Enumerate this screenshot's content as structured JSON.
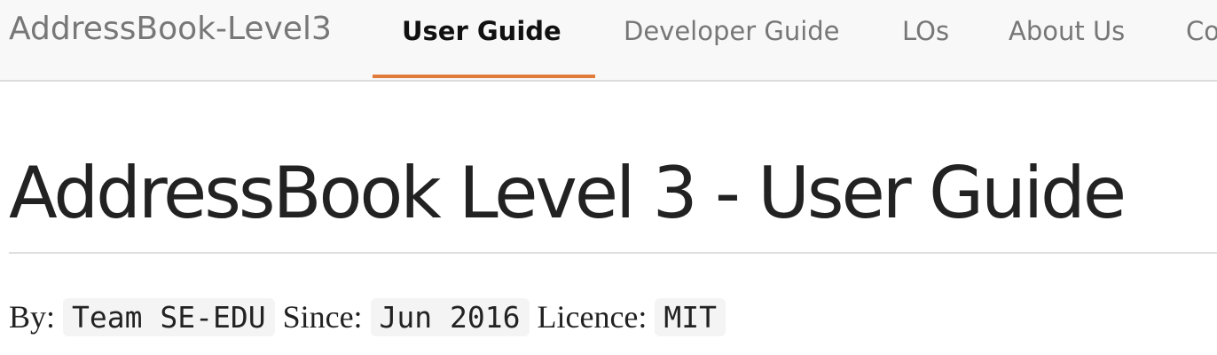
{
  "navbar": {
    "brand": "AddressBook-Level3",
    "items": [
      {
        "label": "User Guide",
        "active": true
      },
      {
        "label": "Developer Guide",
        "active": false
      },
      {
        "label": "LOs",
        "active": false
      },
      {
        "label": "About Us",
        "active": false
      },
      {
        "label": "Co",
        "active": false
      }
    ],
    "accent_color": "#e07b39"
  },
  "page": {
    "title": "AddressBook Level 3 - User Guide",
    "meta": {
      "by_label": "By:",
      "by_value": "Team SE-EDU",
      "since_label": "Since:",
      "since_value": "Jun 2016",
      "licence_label": "Licence:",
      "licence_value": "MIT"
    }
  }
}
